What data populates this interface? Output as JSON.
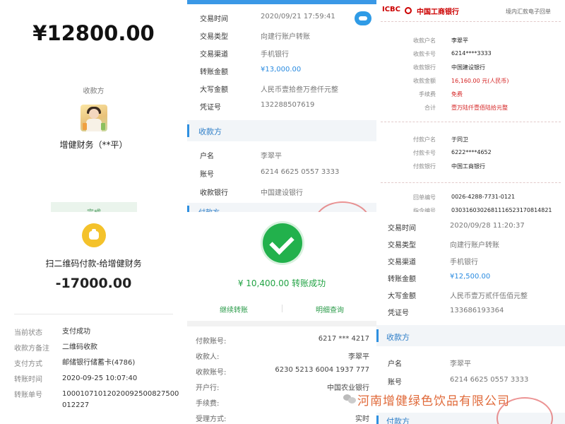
{
  "panel_alipay": {
    "amount": "¥12800.00",
    "payee_label": "收款方",
    "payee_name": "增健财务（**平）",
    "done_button": "完成"
  },
  "panel_ccb_top": {
    "rows": [
      {
        "k": "交易时间",
        "v": "2020/09/21  17:59:41"
      },
      {
        "k": "交易类型",
        "v": "向建行账户转账"
      },
      {
        "k": "交易渠道",
        "v": "手机银行"
      },
      {
        "k": "转账金额",
        "v": "¥13,000.00"
      },
      {
        "k": "大写金额",
        "v": "人民币壹拾叁万叁仟元整"
      },
      {
        "k": "凭证号",
        "v": "132288507619"
      }
    ],
    "section_title": "收款方",
    "payee_rows": [
      {
        "k": "户名",
        "v": "李翠平"
      },
      {
        "k": "账号",
        "v": "6214 6625 0557 3333"
      },
      {
        "k": "收款银行",
        "v": "中国建设银行"
      }
    ],
    "footer_partial": "付款方"
  },
  "panel_icbc": {
    "logo": "ICBC",
    "bank_name": "中国工商银行",
    "receipt_title": "境内汇款电子回单",
    "payee_rows": [
      {
        "k": "收款户名",
        "v": "李翠平",
        "red": false
      },
      {
        "k": "收款卡号",
        "v": "6214****3333",
        "red": false
      },
      {
        "k": "收款银行",
        "v": "中国建设银行",
        "red": false
      },
      {
        "k": "收款金额",
        "v": "16,160.00  元(人民币)",
        "red": true
      },
      {
        "k": "手续费",
        "v": "免费",
        "red": true
      },
      {
        "k": "合计",
        "v": "壹万陆仟壹佰陆拾元整",
        "red": true
      }
    ],
    "payer_rows": [
      {
        "k": "付款户名",
        "v": "于同卫"
      },
      {
        "k": "付款卡号",
        "v": "6222****4652"
      },
      {
        "k": "付款银行",
        "v": "中国工商银行"
      }
    ],
    "extra_rows": [
      {
        "k": "回单编号",
        "v": "0026-4288-7731-0121"
      },
      {
        "k": "指令编号",
        "v": "0303160302681116523170814821"
      }
    ]
  },
  "panel_qr": {
    "title": "扫二维码付款-给增健财务",
    "amount": "-17000.00",
    "rows": [
      {
        "k": "当前状态",
        "v": "支付成功"
      },
      {
        "k": "收款方备注",
        "v": "二维码收款"
      },
      {
        "k": "支付方式",
        "v": "邮储银行储蓄卡(4786)"
      },
      {
        "k": "转账时间",
        "v": "2020-09-25 10:07:40"
      },
      {
        "k": "转账单号",
        "v": "10001071012020092500827500012227"
      }
    ]
  },
  "panel_abc": {
    "status": "¥ 10,400.00  转账成功",
    "link_continue": "继续转账",
    "link_detail": "明细查询",
    "rows": [
      {
        "k": "付款账号:",
        "v": "6217 *** 4217"
      },
      {
        "k": "收款人:",
        "v": "李翠平"
      },
      {
        "k": "收款账号:",
        "v": "6230 5213 6004 1937 777"
      },
      {
        "k": "开户行:",
        "v": "中国农业银行"
      },
      {
        "k": "手续费:",
        "v": ""
      },
      {
        "k": "受理方式:",
        "v": "实时"
      }
    ]
  },
  "panel_ccb_bottom": {
    "rows": [
      {
        "k": "交易时间",
        "v": "2020/09/28  11:20:37"
      },
      {
        "k": "交易类型",
        "v": "向建行账户转账"
      },
      {
        "k": "交易渠道",
        "v": "手机银行"
      },
      {
        "k": "转账金额",
        "v": "¥12,500.00"
      },
      {
        "k": "大写金额",
        "v": "人民币壹万贰仟伍佰元整"
      },
      {
        "k": "凭证号",
        "v": "133686193364"
      }
    ],
    "section_title": "收款方",
    "payee_rows": [
      {
        "k": "户名",
        "v": "李翠平"
      },
      {
        "k": "账号",
        "v": "6214 6625 0557 3333"
      }
    ],
    "footer_partial": "付款方"
  },
  "watermark": "河南增健绿色饮品有限公司",
  "colors": {
    "ccb_blue": "#2f90e0",
    "amount_blue": "#2a8be0",
    "icbc_red": "#c00000",
    "success_green": "#22b14c",
    "coin_yellow": "#f4c22b",
    "watermark_orange": "#e06a3a"
  }
}
